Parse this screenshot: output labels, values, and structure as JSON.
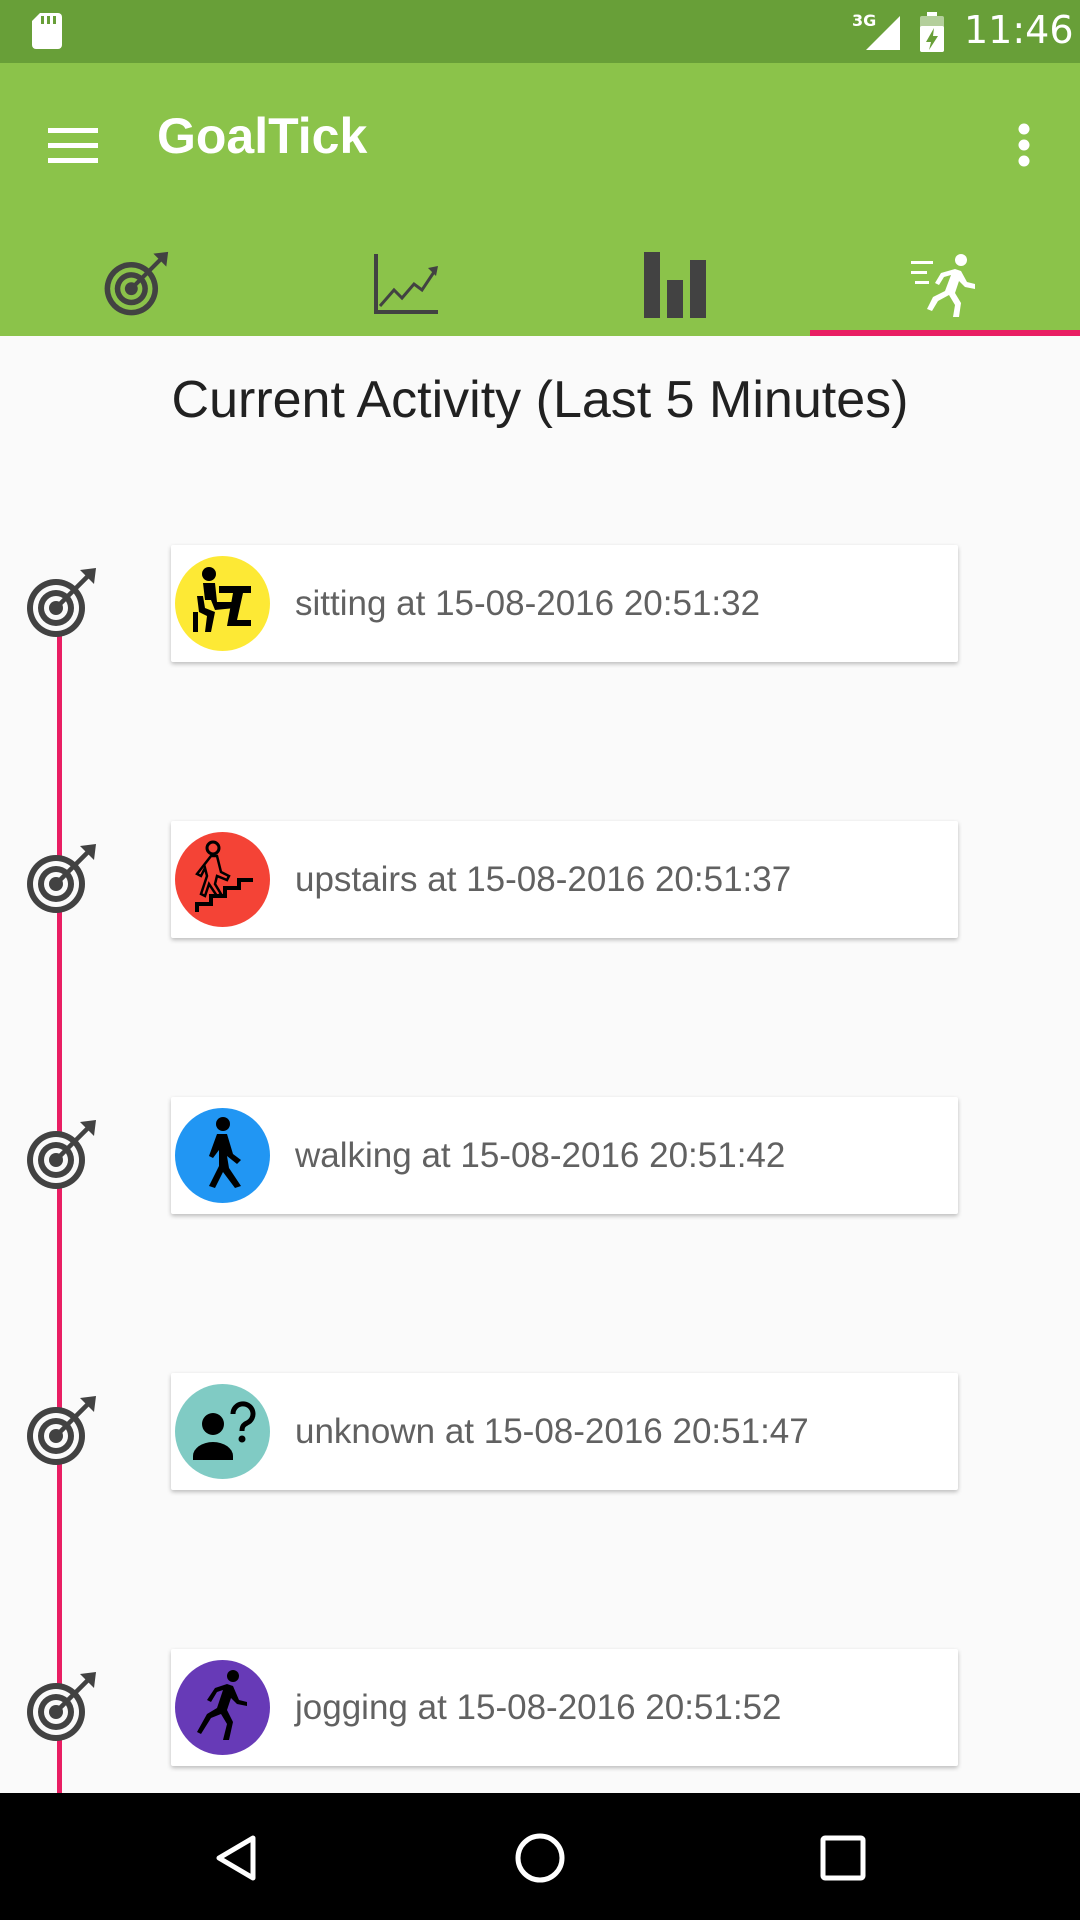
{
  "status_bar": {
    "time": "11:46",
    "network": "3G"
  },
  "app": {
    "title": "GoalTick"
  },
  "tabs": [
    {
      "icon": "target-icon",
      "selected": false
    },
    {
      "icon": "line-chart-icon",
      "selected": false
    },
    {
      "icon": "bar-chart-icon",
      "selected": false
    },
    {
      "icon": "running-person-icon",
      "selected": true
    }
  ],
  "heading": "Current Activity (Last 5 Minutes)",
  "activities": [
    {
      "label": "sitting at 15-08-2016 20:51:32",
      "icon": "sitting-person-icon",
      "color": "#fde935"
    },
    {
      "label": "upstairs at 15-08-2016 20:51:37",
      "icon": "stairs-person-icon",
      "color": "#f44336"
    },
    {
      "label": "walking at 15-08-2016 20:51:42",
      "icon": "walking-person-icon",
      "color": "#2196f3"
    },
    {
      "label": "unknown at 15-08-2016 20:51:47",
      "icon": "unknown-person-icon",
      "color": "#80cbc4"
    },
    {
      "label": "jogging at 15-08-2016 20:51:52",
      "icon": "jogging-person-icon",
      "color": "#673ab7"
    }
  ],
  "colors": {
    "primary": "#8bc34a",
    "primary_dark": "#689f38",
    "accent": "#e91e63"
  }
}
